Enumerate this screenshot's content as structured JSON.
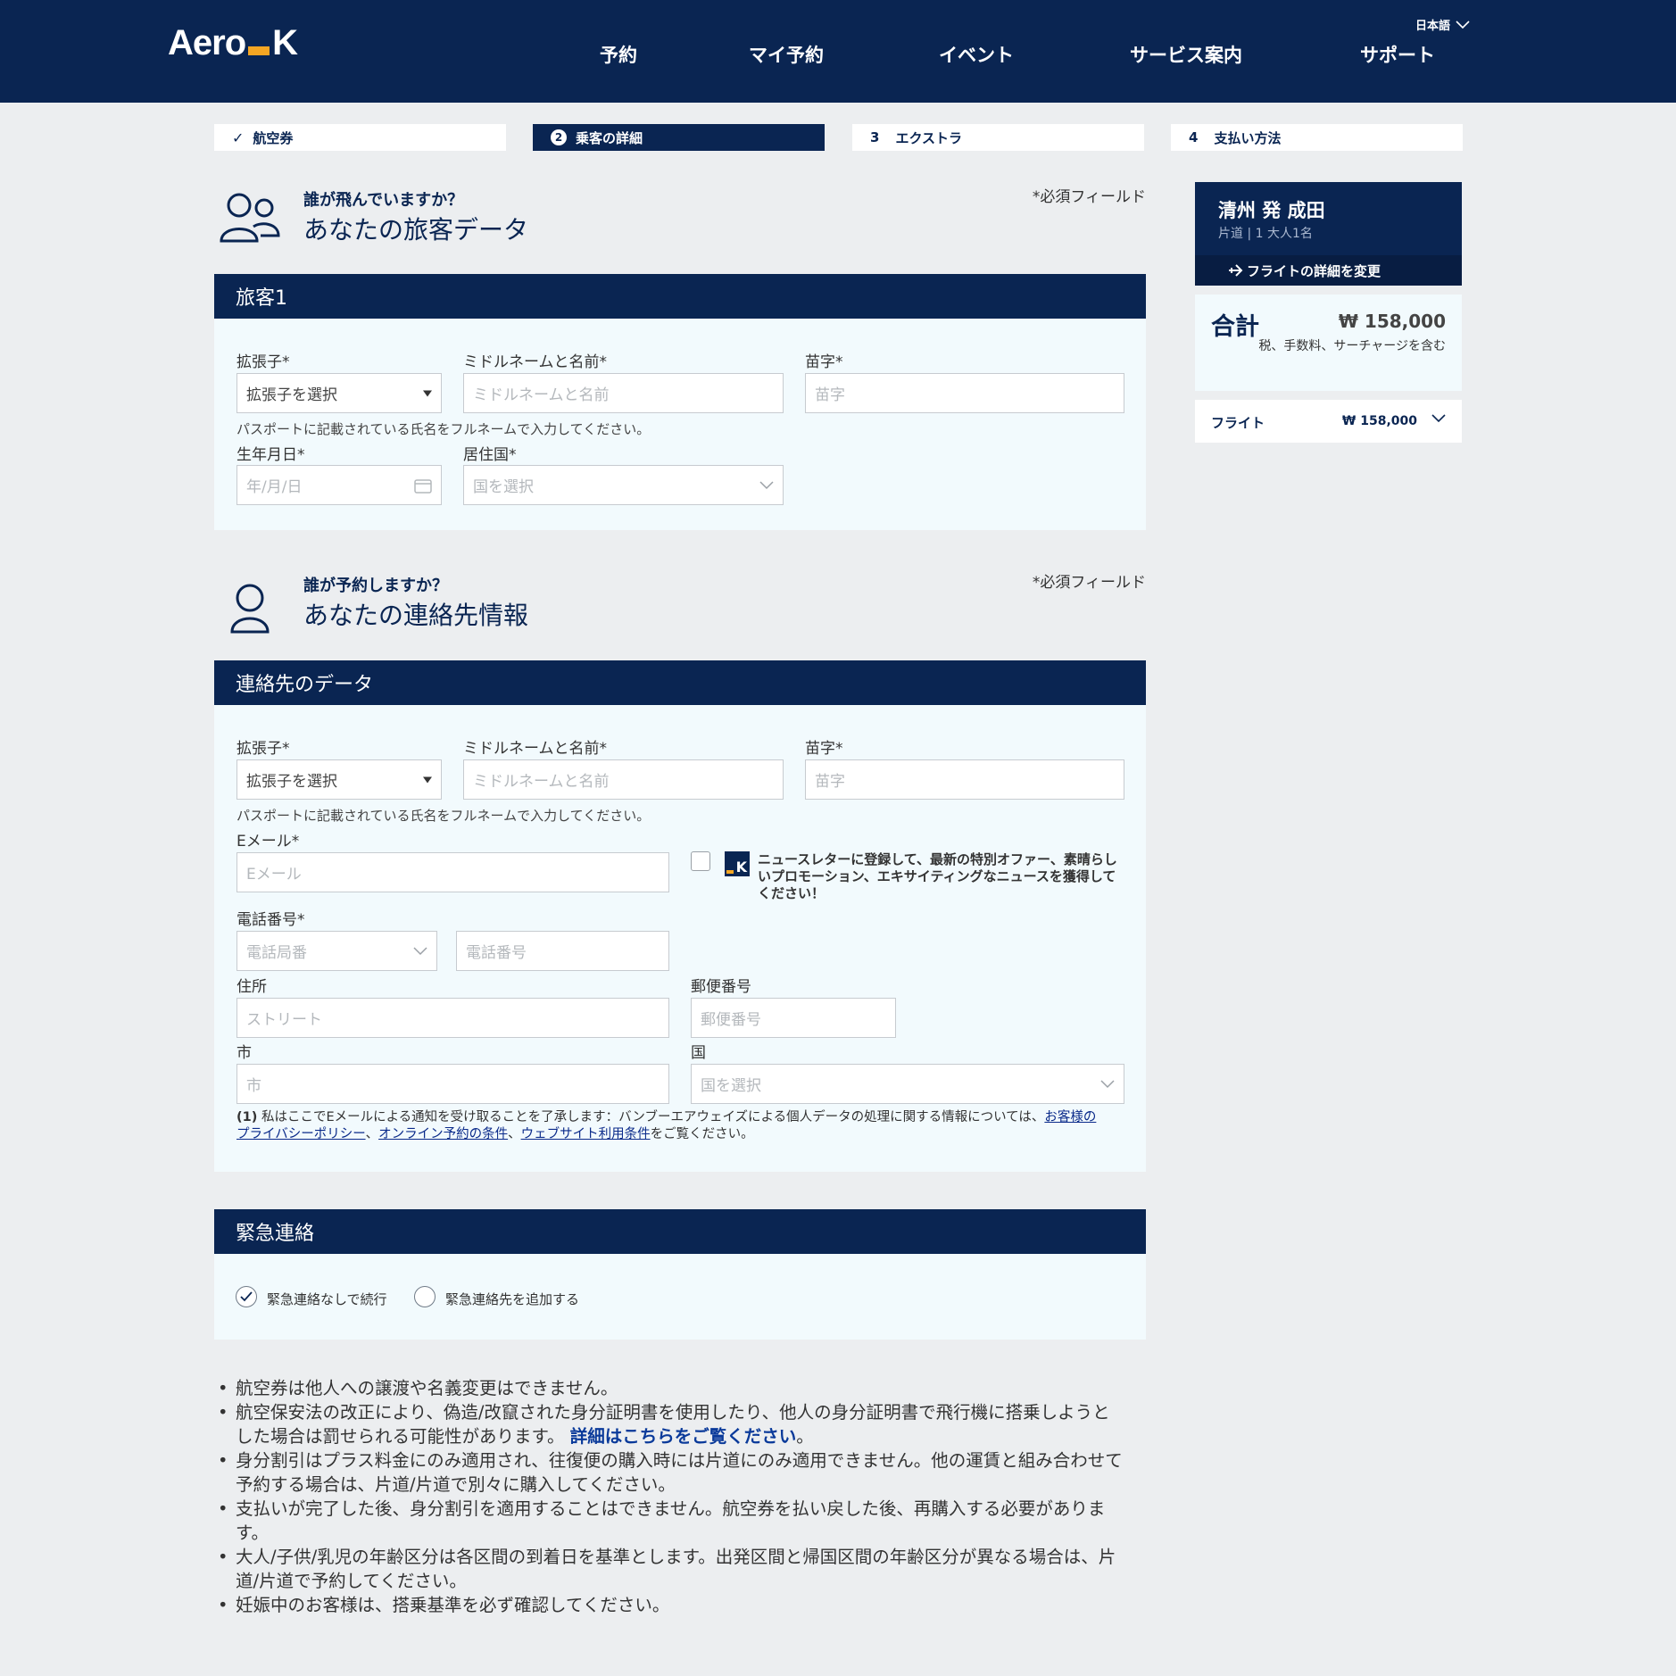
{
  "brand": {
    "logo_left": "Aero",
    "logo_right": "K"
  },
  "nav": {
    "items": [
      "予約",
      "マイ予約",
      "イベント",
      "サービス案内",
      "サポート"
    ],
    "language": "日本語"
  },
  "steps": [
    {
      "num": "",
      "label": "航空券",
      "state": "done"
    },
    {
      "num": "2",
      "label": "乗客の詳細",
      "state": "active"
    },
    {
      "num": "3",
      "label": "エクストラ",
      "state": "pending"
    },
    {
      "num": "4",
      "label": "支払い方法",
      "state": "pending"
    }
  ],
  "passenger_section": {
    "subtitle": "誰が飛んでいますか？",
    "title": "あなたの旅客データ",
    "required_note": "*必須フィールド",
    "card_title": "旅客1",
    "prefix_label": "拡張子*",
    "prefix_value": "拡張子を選択",
    "middle_label": "ミドルネームと名前*",
    "middle_placeholder": "ミドルネームと名前",
    "surname_label": "苗字*",
    "surname_placeholder": "苗字",
    "hint": "パスポートに記載されている氏名をフルネームで入力してください。",
    "dob_label": "生年月日*",
    "dob_placeholder": "年/月/日",
    "residence_label": "居住国*",
    "residence_placeholder": "国を選択"
  },
  "contact_section": {
    "subtitle": "誰が予約しますか？",
    "title": "あなたの連絡先情報",
    "required_note": "*必須フィールド",
    "card_title": "連絡先のデータ",
    "prefix_label": "拡張子*",
    "prefix_value": "拡張子を選択",
    "middle_label": "ミドルネームと名前*",
    "middle_placeholder": "ミドルネームと名前",
    "surname_label": "苗字*",
    "surname_placeholder": "苗字",
    "hint": "パスポートに記載されている氏名をフルネームで入力してください。",
    "email_label": "Eメール*",
    "email_placeholder": "Eメール",
    "newsletter_text_1": "ニュースレターに登録して、最新の特別オファー、素晴らし",
    "newsletter_text_2": "いプロモーション、エキサイティングなニュースを獲得して",
    "newsletter_text_3": "ください！",
    "phone_label": "電話番号*",
    "phone_code_placeholder": "電話局番",
    "phone_placeholder": "電話番号",
    "address_label": "住所",
    "address_placeholder": "ストリート",
    "postal_label": "郵便番号",
    "postal_placeholder": "郵便番号",
    "city_label": "市",
    "city_placeholder": "市",
    "country_label": "国",
    "country_placeholder": "国を選択",
    "consent_num": "(1)",
    "consent_text": " 私はここでEメールによる通知を受け取ることを了承します：バンブーエアウェイズによる個人データの処理に関する情報については、",
    "consent_link_1a": "お客様の",
    "consent_link_1b": "プライバシーポリシー",
    "consent_sep_1": "、",
    "consent_link_2": "オンライン予約の条件",
    "consent_sep_2": "、",
    "consent_link_3": "ウェブサイト利用条件",
    "consent_tail": "をご覧ください。"
  },
  "emergency_section": {
    "card_title": "緊急連絡",
    "option_1": "緊急連絡なしで続行",
    "option_2": "緊急連絡先を追加する",
    "selected": "option_1"
  },
  "notes": {
    "n1": "航空券は他人への譲渡や名義変更はできません。",
    "n2a": "航空保安法の改正により、偽造/改竄された身分証明書を使用したり、他人の身分証明書で飛行機に搭乗しようと",
    "n2b": "した場合は罰せられる可能性があります。 ",
    "n2_link": "詳細はこちらをご覧ください",
    "n2_end": "。",
    "n3a": "身分割引はプラス料金にのみ適用され、往復便の購入時には片道にのみ適用できません。他の運賃と組み合わせて",
    "n3b": "予約する場合は、片道/片道で別々に購入してください。",
    "n4a": "支払いが完了した後、身分割引を適用することはできません。航空券を払い戻した後、再購入する必要がありま",
    "n4b": "す。",
    "n5a": "大人/子供/乳児の年齢区分は各区間の到着日を基準とします。出発区間と帰国区間の年齢区分が異なる場合は、片",
    "n5b": "道/片道で予約してください。",
    "n6": "妊娠中のお客様は、搭乗基準を必ず確認してください。"
  },
  "sidebar": {
    "route_title": "清州 発 成田",
    "route_info": "片道 | 1 大人1名",
    "change_link": "フライトの詳細を変更",
    "total_label": "合計",
    "total_amount": "₩ 158,000",
    "total_note": "税、手数料、サーチャージを含む",
    "flight_label": "フライト",
    "flight_amount": "₩ 158,000"
  },
  "colors": {
    "navy": "#0a2552",
    "accent": "#f5a623",
    "card_bg": "#f2fafd",
    "page_bg": "#eceef0"
  }
}
